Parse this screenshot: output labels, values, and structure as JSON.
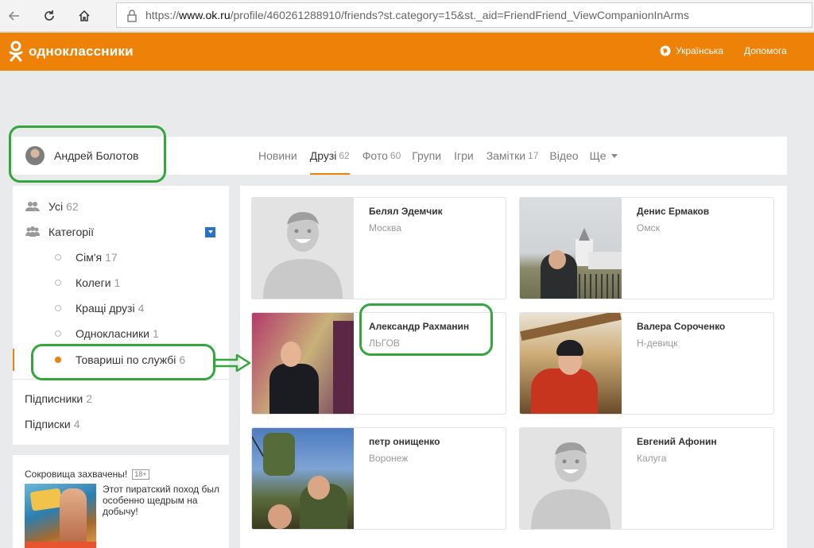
{
  "browser": {
    "url_prefix": "https://",
    "url_domain": "www.ok.ru",
    "url_path": "/profile/460261288910/friends?st.category=15&st._aid=FriendFriend_ViewCompanionInArms"
  },
  "header": {
    "logo_text": "одноклассники",
    "language": "Українська",
    "help": "Допомога",
    "brand_color": "#ee8208"
  },
  "profile": {
    "name": "Андрей Болотов"
  },
  "tabs": [
    {
      "label": "Новини",
      "count": ""
    },
    {
      "label": "Друзі",
      "count": "62"
    },
    {
      "label": "Фото",
      "count": "60"
    },
    {
      "label": "Групи",
      "count": ""
    },
    {
      "label": "Ігри",
      "count": ""
    },
    {
      "label": "Замітки",
      "count": "17"
    },
    {
      "label": "Відео",
      "count": ""
    },
    {
      "label": "Ще",
      "count": ""
    }
  ],
  "sidebar": {
    "all": {
      "label": "Усі",
      "count": "62"
    },
    "categories": {
      "label": "Категорії"
    },
    "sub": [
      {
        "label": "Сім'я",
        "count": "17"
      },
      {
        "label": "Колеги",
        "count": "1"
      },
      {
        "label": "Кращі друзі",
        "count": "4"
      },
      {
        "label": "Однокласники",
        "count": "1"
      },
      {
        "label": "Товариші по службі",
        "count": "6"
      }
    ],
    "subscribers": {
      "label": "Підписники",
      "count": "2"
    },
    "subscriptions": {
      "label": "Підписки",
      "count": "4"
    }
  },
  "ad": {
    "title": "Сокровища захвачены!",
    "age": "18+",
    "text": "Этот пиратский поход был особенно щедрым на добычу!"
  },
  "friends": [
    {
      "name": "Белял Эдемчик",
      "city": "Москва"
    },
    {
      "name": "Денис Ермаков",
      "city": "Омск"
    },
    {
      "name": "Александр Рахманин",
      "city": "ЛЬГОВ"
    },
    {
      "name": "Валера Сороченко",
      "city": "Н-девицк"
    },
    {
      "name": "петр онищенко",
      "city": "Воронеж"
    },
    {
      "name": "Евгений Афонин",
      "city": "Калуга"
    }
  ]
}
